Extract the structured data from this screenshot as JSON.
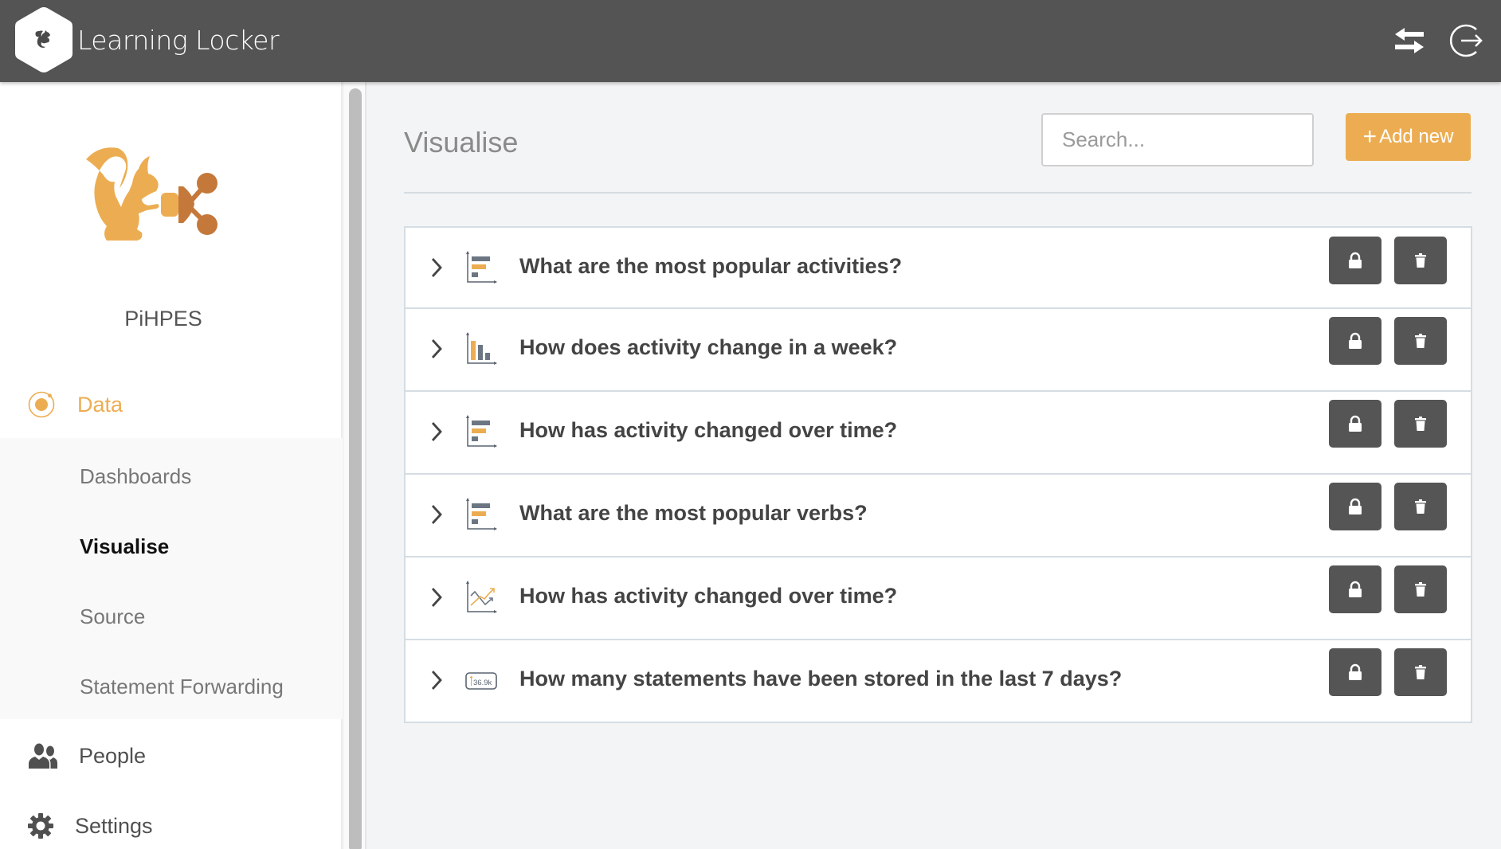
{
  "app": {
    "name": "Learning Locker",
    "header_icons": [
      "switch-arrows-icon",
      "logout-icon"
    ]
  },
  "sidebar": {
    "org_name": "PiHPES",
    "data_label": "Data",
    "sub_items": [
      {
        "label": "Dashboards",
        "active": false
      },
      {
        "label": "Visualise",
        "active": true
      },
      {
        "label": "Source",
        "active": false
      },
      {
        "label": "Statement Forwarding",
        "active": false
      }
    ],
    "people_label": "People",
    "settings_label": "Settings"
  },
  "main": {
    "title": "Visualise",
    "search_placeholder": "Search...",
    "search_value": "",
    "add_button": {
      "plus": "+",
      "label": "Add new"
    },
    "visualisations": [
      {
        "title": "What are the most popular activities?",
        "icon": "horizontal-bar-chart-icon"
      },
      {
        "title": "How does activity change in a week?",
        "icon": "column-chart-icon"
      },
      {
        "title": "How has activity changed over time?",
        "icon": "horizontal-bar-chart-icon"
      },
      {
        "title": "What are the most popular verbs?",
        "icon": "horizontal-bar-chart-icon"
      },
      {
        "title": "How has activity changed over time?",
        "icon": "line-chart-icon"
      },
      {
        "title": "How many statements have been stored in the last 7 days?",
        "icon": "counter-icon",
        "icon_text": "36.9k"
      }
    ]
  },
  "colors": {
    "accent": "#ecad52",
    "header_bg": "#545454",
    "action_button_bg": "#555555",
    "main_bg": "#f3f4f6"
  }
}
